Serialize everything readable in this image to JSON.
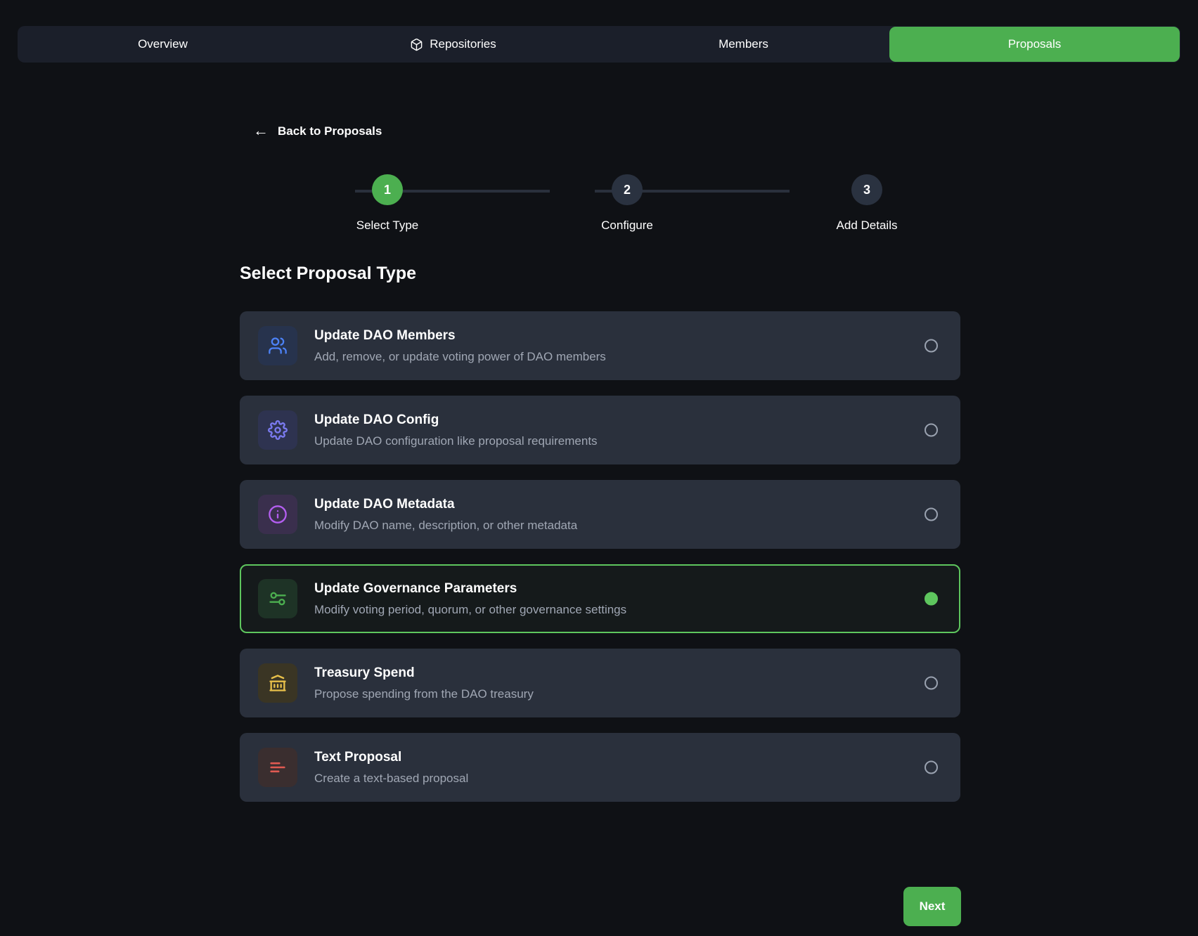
{
  "nav": {
    "tabs": [
      {
        "label": "Overview",
        "icon": "",
        "active": false
      },
      {
        "label": "Repositories",
        "icon": "package-icon",
        "active": false
      },
      {
        "label": "Members",
        "icon": "",
        "active": false
      },
      {
        "label": "Proposals",
        "icon": "",
        "active": true
      }
    ],
    "active_color": "#4caf50"
  },
  "back_link": {
    "label": "Back to Proposals",
    "icon": "arrow-left-icon"
  },
  "stepper": {
    "steps": [
      {
        "number": "1",
        "label": "Select Type",
        "state": "done"
      },
      {
        "number": "2",
        "label": "Configure",
        "state": "pending"
      },
      {
        "number": "3",
        "label": "Add Details",
        "state": "pending"
      }
    ],
    "done_color": "#4caf50",
    "pending_color": "#2a3240"
  },
  "main": {
    "title": "Select Proposal Type",
    "proposal_types": [
      {
        "title": "Update DAO Members",
        "description": "Add, remove, or update voting power of DAO members",
        "icon": "users-icon",
        "icon_color": "#4c82f7",
        "icon_bg": "#27334d",
        "selected": false
      },
      {
        "title": "Update DAO Config",
        "description": "Update DAO configuration like proposal requirements",
        "icon": "gear-icon",
        "icon_color": "#7b7bf0",
        "icon_bg": "#2e3350",
        "selected": false
      },
      {
        "title": "Update DAO Metadata",
        "description": "Modify DAO name, description, or other metadata",
        "icon": "info-icon",
        "icon_color": "#b45ef0",
        "icon_bg": "#3a2f4d",
        "selected": false
      },
      {
        "title": "Update Governance Parameters",
        "description": "Modify voting period, quorum, or other governance settings",
        "icon": "sliders-icon",
        "icon_color": "#4caf50",
        "icon_bg": "#1e3326",
        "selected": true
      },
      {
        "title": "Treasury Spend",
        "description": "Propose spending from the DAO treasury",
        "icon": "bank-icon",
        "icon_color": "#e8c04a",
        "icon_bg": "#3a3524",
        "selected": false
      },
      {
        "title": "Text Proposal",
        "description": "Create a text-based proposal",
        "icon": "align-left-icon",
        "icon_color": "#e05a52",
        "icon_bg": "#3a2e2f",
        "selected": false
      }
    ]
  },
  "footer": {
    "next_label": "Next"
  }
}
